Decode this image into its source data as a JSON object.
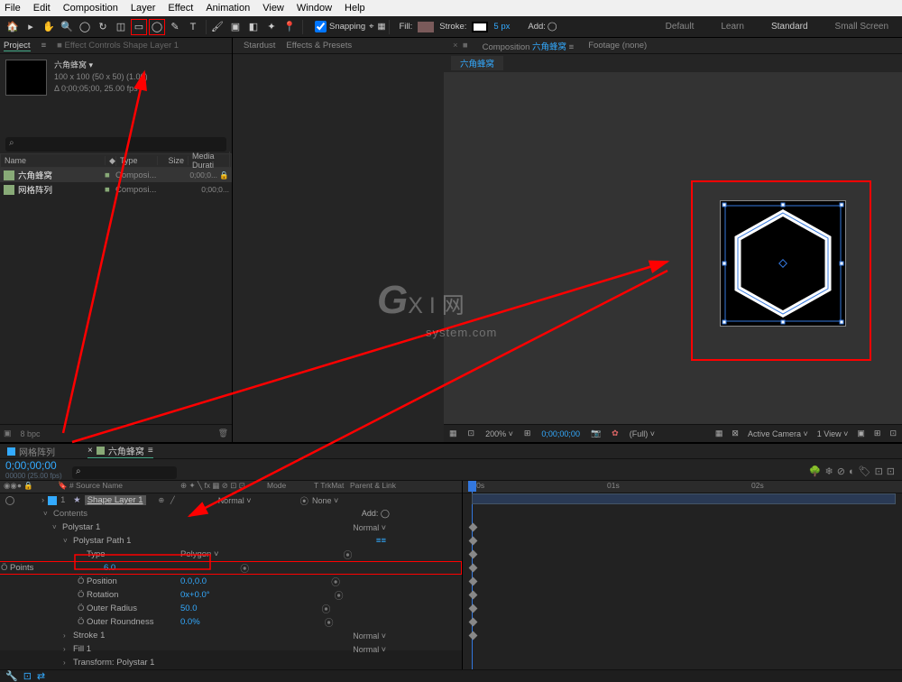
{
  "menu": {
    "items": [
      "File",
      "Edit",
      "Composition",
      "Layer",
      "Effect",
      "Animation",
      "View",
      "Window",
      "Help"
    ]
  },
  "toolbar": {
    "snapping": "Snapping",
    "fill": "Fill:",
    "stroke": "Stroke:",
    "strokepx": "5 px",
    "add": "Add:"
  },
  "workspaces": {
    "a": "Default",
    "b": "Learn",
    "c": "Standard",
    "d": "Small Screen"
  },
  "project": {
    "tab": "Project",
    "fxtab": "Effect Controls Shape Layer 1",
    "title": "六角蜂窝 ▾",
    "line1": "100 x 100  (50 x 50) (1.00)",
    "line2": "Δ 0;00;05;00, 25.00 fps",
    "cols": {
      "name": "Name",
      "type": "Type",
      "size": "Size",
      "md": "Media Durati"
    },
    "rows": [
      {
        "name": "六角蜂窝",
        "type": "Composi...",
        "dur": "0;00;0... 🔒"
      },
      {
        "name": "网格阵列",
        "type": "Composi...",
        "dur": "0;00;0..."
      }
    ],
    "bpc": "8 bpc"
  },
  "center": {
    "a": "Stardust",
    "b": "Effects & Presets"
  },
  "comp": {
    "label": "Composition",
    "name": "六角蜂窝",
    "footage": "Footage (none)",
    "subtab": "六角蜂窝"
  },
  "viewerFooter": {
    "zoom": "200%",
    "time": "0;00;00;00",
    "full": "(Full)",
    "cam": "Active Camera",
    "view": "1 View"
  },
  "timeline": {
    "tabs": {
      "a": "网格阵列",
      "b": "六角蜂窝"
    },
    "time": "0;00;00;00",
    "frames": "00000 (25.00 fps)",
    "cols": {
      "src": "Source Name",
      "mode": "Mode",
      "trk": "T  TrkMat",
      "parent": "Parent & Link"
    },
    "layer": "Shape Layer 1",
    "num": "1",
    "normal": "Normal",
    "none": "None",
    "contents": "Contents",
    "add": "Add:",
    "polystar": "Polystar 1",
    "path": "Polystar Path 1",
    "props": {
      "type": {
        "n": "Type",
        "v": "Polygon"
      },
      "points": {
        "n": "Points",
        "v": "6.0"
      },
      "position": {
        "n": "Position",
        "v": "0.0,0.0"
      },
      "rotation": {
        "n": "Rotation",
        "v": "0x+0.0°"
      },
      "oradius": {
        "n": "Outer Radius",
        "v": "50.0"
      },
      "oround": {
        "n": "Outer Roundness",
        "v": "0.0%"
      }
    },
    "stroke": "Stroke 1",
    "fill": "Fill 1",
    "xform": "Transform: Polystar 1",
    "ruler": {
      "a": ":00s",
      "b": "01s",
      "c": "02s"
    }
  },
  "watermark": {
    "a": "G",
    "b": "X I",
    "c": "网",
    "d": "system.com"
  }
}
